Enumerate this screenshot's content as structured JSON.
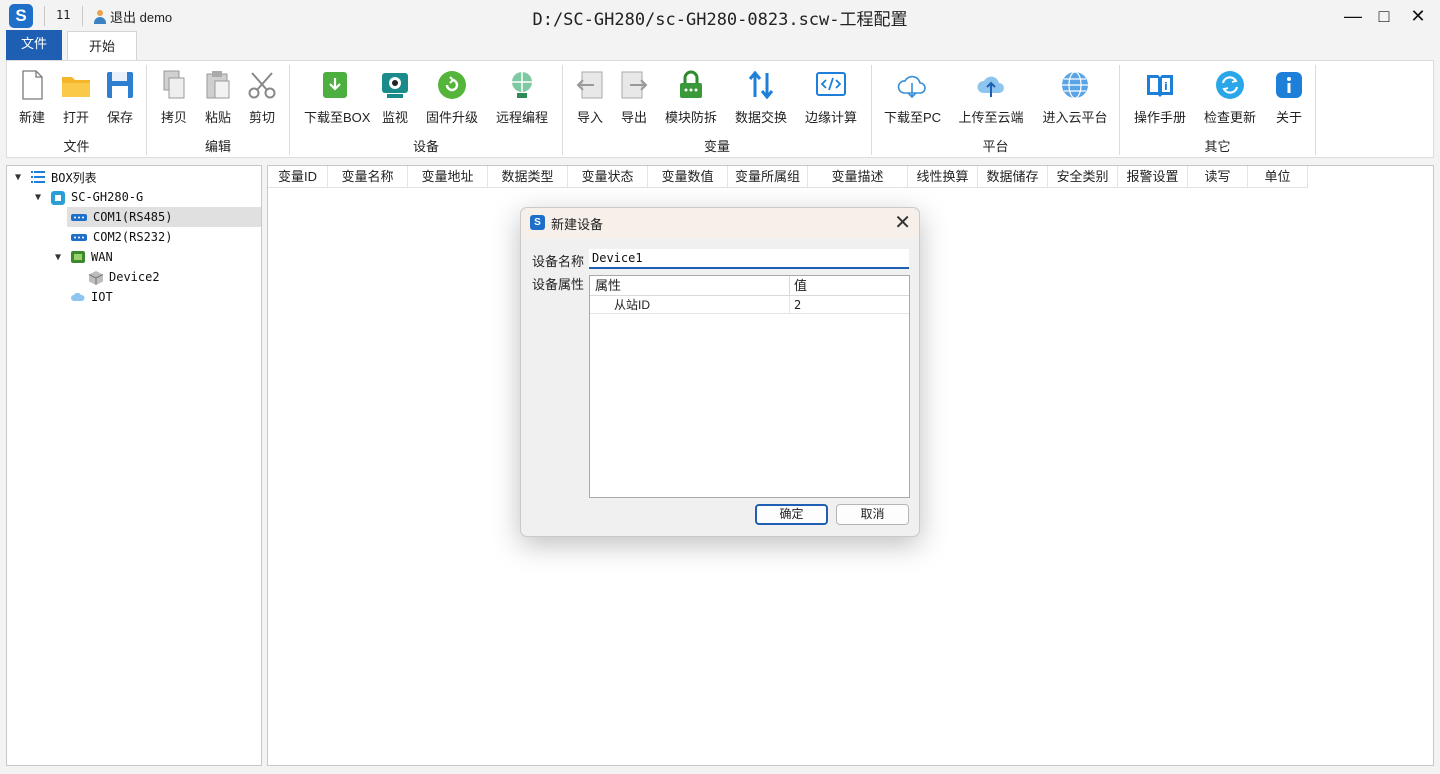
{
  "titlebar": {
    "logo": "S",
    "count": "11",
    "user": "退出 demo",
    "title": "D:/SC-GH280/sc-GH280-0823.scw-工程配置",
    "minimize": "—",
    "maximize": "□",
    "close": "✕"
  },
  "tabs": {
    "file": "文件",
    "start": "开始"
  },
  "ribbon": {
    "groups": {
      "file": "文件",
      "edit": "编辑",
      "device": "设备",
      "variable": "变量",
      "platform": "平台",
      "other": "其它"
    },
    "buttons": {
      "new": "新建",
      "open": "打开",
      "save": "保存",
      "copy": "拷贝",
      "paste": "粘贴",
      "cut": "剪切",
      "download_box": "下载至BOX",
      "monitor": "监视",
      "firmware": "固件升级",
      "remote": "远程编程",
      "import": "导入",
      "export": "导出",
      "module_protect": "模块防拆",
      "data_exchange": "数据交换",
      "edge_compute": "边缘计算",
      "download_pc": "下载至PC",
      "upload_cloud": "上传至云端",
      "enter_cloud": "进入云平台",
      "manual": "操作手册",
      "check_update": "检查更新",
      "about": "关于"
    }
  },
  "tree": {
    "root": "BOX列表",
    "box": "SC-GH280-G",
    "com1": "COM1(RS485)",
    "com2": "COM2(RS232)",
    "wan": "WAN",
    "device2": "Device2",
    "iot": "IOT"
  },
  "table": {
    "columns": [
      "变量ID",
      "变量名称",
      "变量地址",
      "数据类型",
      "变量状态",
      "变量数值",
      "变量所属组",
      "变量描述",
      "线性换算",
      "数据储存",
      "安全类别",
      "报警设置",
      "读写",
      "单位"
    ]
  },
  "dialog": {
    "logo": "S",
    "title": "新建设备",
    "close": "✕",
    "name_label": "设备名称",
    "name_value": "Device1",
    "props_label": "设备属性",
    "col_prop": "属性",
    "col_value": "值",
    "rows": [
      {
        "prop": "从站ID",
        "value": "2"
      }
    ],
    "ok": "确定",
    "cancel": "取消"
  },
  "colors": {
    "accent": "#1e5fb3",
    "logo": "#1f6fc9",
    "green": "#4caf3f",
    "orange": "#f5a623"
  }
}
